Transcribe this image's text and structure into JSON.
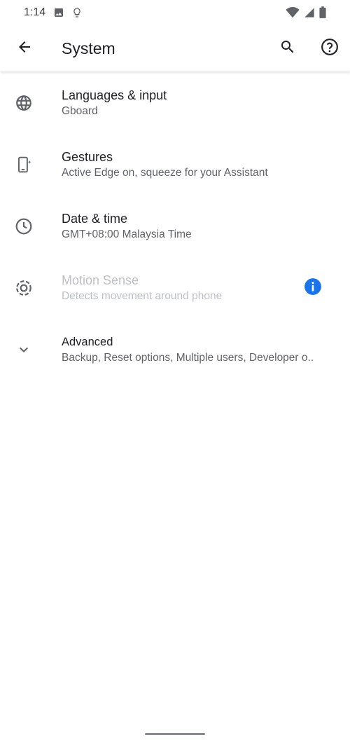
{
  "status_bar": {
    "time": "1:14",
    "left_icons": [
      "image-icon",
      "lightbulb-icon"
    ],
    "right_icons": [
      "wifi-icon",
      "signal-icon",
      "battery-icon"
    ]
  },
  "app_bar": {
    "title": "System",
    "back_icon": "back-arrow-icon",
    "search_icon": "search-icon",
    "help_icon": "help-icon"
  },
  "items": [
    {
      "title": "Languages & input",
      "summary": "Gboard",
      "icon": "globe-icon",
      "enabled": true
    },
    {
      "title": "Gestures",
      "summary": "Active Edge on, squeeze for your Assistant",
      "icon": "phone-gesture-icon",
      "enabled": true
    },
    {
      "title": "Date & time",
      "summary": "GMT+08:00 Malaysia Time",
      "icon": "clock-icon",
      "enabled": true
    },
    {
      "title": "Motion Sense",
      "summary": "Detects movement around phone",
      "icon": "motion-sense-icon",
      "enabled": false,
      "trailing_icon": "info-icon"
    },
    {
      "title": "Advanced",
      "summary": "Backup, Reset options, Multiple users, Developer o..",
      "icon": "chevron-down-icon",
      "enabled": true
    }
  ],
  "colors": {
    "accent": "#1a73e8",
    "text_primary": "#202124",
    "text_secondary": "#5f6368",
    "text_disabled": "#bdc1c6"
  }
}
